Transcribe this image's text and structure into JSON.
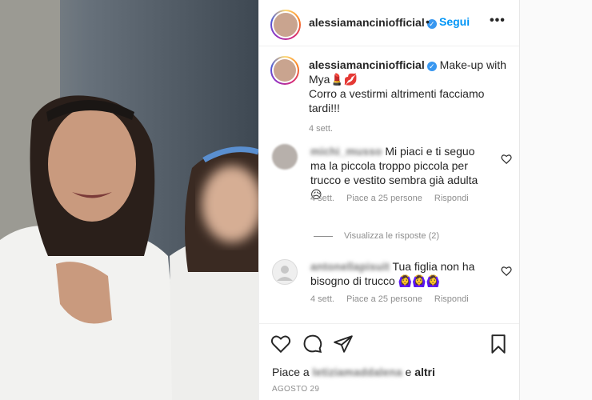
{
  "post": {
    "username": "alessiamanciniofficial",
    "dot": "•",
    "follow_label": "Segui",
    "more_label": "•••",
    "caption_line1": "Make-up with Mya💄💋",
    "caption_line2": "Corro a vestirmi altrimenti facciamo tardi!!!",
    "caption_time": "4 sett."
  },
  "comments": [
    {
      "username": "michi_musso",
      "text": "Mi piaci e ti seguo ma la piccola troppo piccola per trucco e vestito sembra già adulta😥",
      "time": "4 sett.",
      "likes": "Piace a 25 persone",
      "reply": "Rispondi"
    },
    {
      "username": "antonellapisuit",
      "text": "Tua figlia non ha bisogno di trucco 🙆‍♀️🙆‍♀️🙆‍♀️",
      "time": "4 sett.",
      "likes": "Piace a 25 persone",
      "reply": "Rispondi"
    }
  ],
  "view_replies": "Visualizza le risposte (2)",
  "footer": {
    "likes_prefix": "Piace a",
    "likes_user": "letiziamaddalena",
    "likes_mid": "e",
    "likes_others": "altri",
    "date": "AGOSTO 29"
  },
  "icons": [
    "heart-icon",
    "comment-icon",
    "share-icon",
    "bookmark-icon",
    "verified-icon",
    "more-icon"
  ],
  "colors": {
    "accent": "#0095f6",
    "verified": "#3897f0",
    "muted": "#8e8e8e"
  }
}
